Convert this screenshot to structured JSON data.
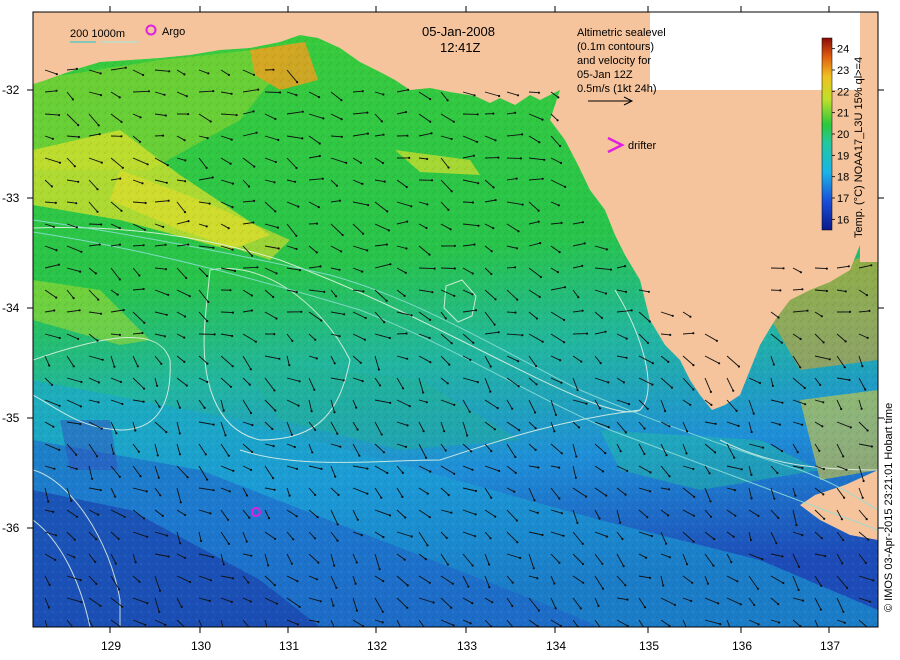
{
  "title": {
    "date": "05-Jan-2008",
    "time": "12:41Z"
  },
  "bathymetry_legend": {
    "label": "200  1000m",
    "color": "#7fd8d0"
  },
  "argo_legend": {
    "label": "Argo",
    "color": "#e020e0"
  },
  "altimetry_note": {
    "lines": [
      "Altimetric sealevel",
      "(0.1m contours)",
      "and velocity for",
      "05-Jan 12Z",
      "0.5m/s (1kt 24h)"
    ]
  },
  "drifter_legend": {
    "label": "drifter",
    "color": "#e020e0"
  },
  "colorbar": {
    "title": "Temp. (°C) NOAA17_L3U 15% ql>=4",
    "ticks": [
      "24",
      "23",
      "22",
      "21",
      "20",
      "19",
      "18",
      "17",
      "16"
    ],
    "vmin": 15.5,
    "vmax": 24.5
  },
  "credit": "© IMOS 03-Apr-2015 23:21:01 Hobart time",
  "axes": {
    "x_ticks": [
      "129",
      "130",
      "131",
      "132",
      "133",
      "134",
      "135",
      "136",
      "137"
    ],
    "y_ticks": [
      "-32",
      "-33",
      "-34",
      "-35",
      "-36"
    ],
    "lon_range": [
      128.2,
      137.5
    ],
    "lat_range": [
      -36.85,
      -31.45
    ]
  },
  "colors": {
    "land": "#f5c49c",
    "sea_deep": "#1e3db0",
    "sea_cool": "#1fa0d8",
    "sea_mid": "#22c23a",
    "sea_warm": "#e6e02a",
    "sea_hot": "#c8641a"
  }
}
